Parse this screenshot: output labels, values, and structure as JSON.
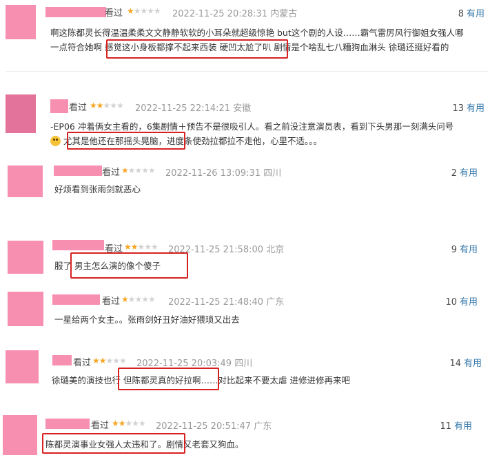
{
  "useful_label": "有用",
  "rated_label": "看过",
  "comments": [
    {
      "stars": 1,
      "datetime": "2022-11-25 20:28:31",
      "location": "内蒙古",
      "votes": "8",
      "lines": [
        "啊这陈都灵长得温温柔柔文文静静软软的小耳朵就超级惊艳 but这个剧的人设……霸气雷厉风行御姐女强人哪",
        "一点符合她啊 感觉这小身板都撑不起来西装 硬凹太尬了叭 剧情是个啥乱七八糟狗血淋头 徐璐还挺好看的"
      ]
    },
    {
      "stars": 2,
      "datetime": "2022-11-25 22:14:21",
      "location": "安徽",
      "votes": "13",
      "lines": [
        "-EP06 冲着俩女主看的，6集剧情＋预告不是很吸引人。看之前没注意演员表，看到下头男那一刻满头问号",
        " 尤其是他还在那摇头晃脑，进度条使劲拉都拉不走他，心里不适。。。"
      ]
    },
    {
      "stars": 1,
      "datetime": "2022-11-26 13:09:31",
      "location": "四川",
      "votes": "2",
      "lines": [
        "好烦看到张雨剑就恶心"
      ]
    },
    {
      "stars": 2,
      "datetime": "2022-11-25 21:58:00",
      "location": "北京",
      "votes": "9",
      "lines": [
        "服了 男主怎么演的像个傻子"
      ]
    },
    {
      "stars": 1,
      "datetime": "2022-11-25 21:48:40",
      "location": "广东",
      "votes": "10",
      "lines": [
        "一星给两个女主。。张雨剑好丑好油好猥琐又出去"
      ]
    },
    {
      "stars": 2,
      "datetime": "2022-11-25 20:03:49",
      "location": "四川",
      "votes": "14",
      "lines": [
        "徐璐美的演技也行 但陈都灵真的好拉啊……对比起来不要太虐 进修进修再来吧"
      ]
    },
    {
      "stars": 2,
      "datetime": "2022-11-25 20:51:47",
      "location": "广东",
      "votes": "11",
      "lines": [
        "陈都灵演事业女强人太违和了。剧情又老套又狗血。"
      ]
    }
  ]
}
